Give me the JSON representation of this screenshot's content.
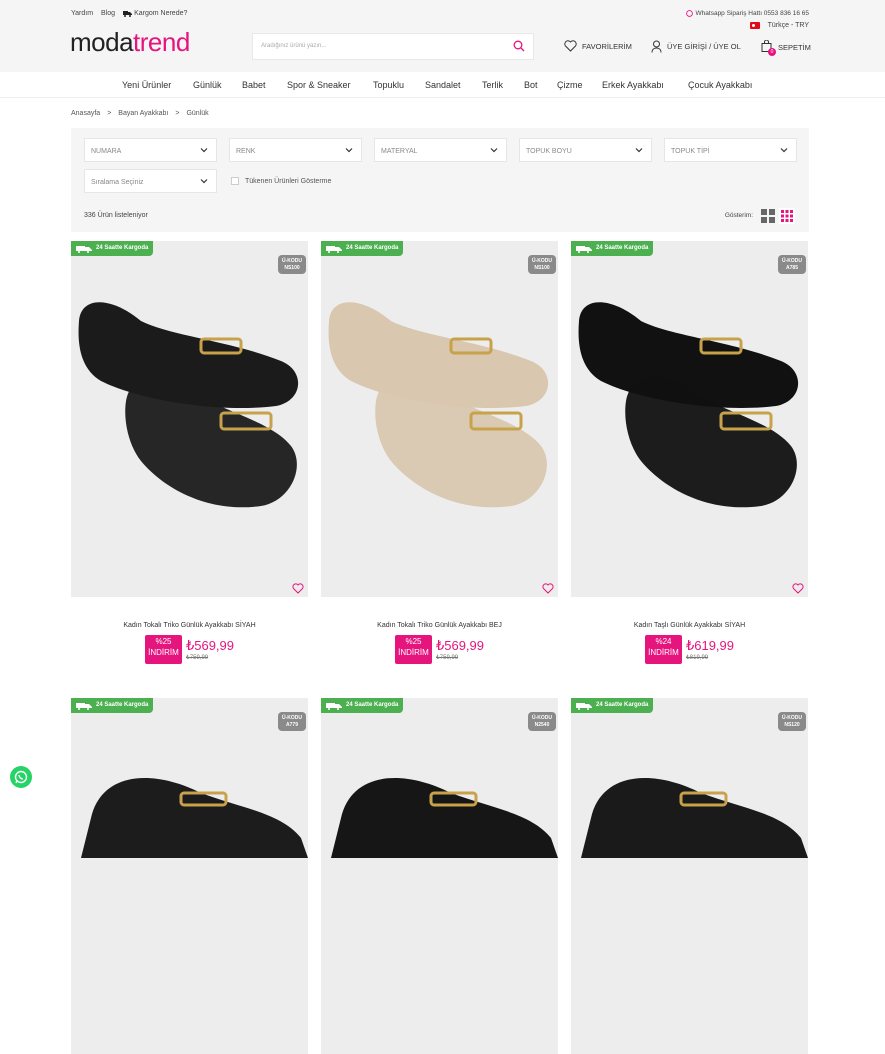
{
  "header": {
    "top_links": [
      "Yardım",
      "Blog",
      "Kargom Nerede?"
    ],
    "logo_dark": "moda",
    "logo_pink": "trend",
    "search_placeholder": "Aradığınız ürünü yazın...",
    "whatsapp": "Whatsapp Sipariş Hattı 0553 836 16 65",
    "language": "Türkçe - TRY",
    "favorites": "FAVORİLERİM",
    "login": "ÜYE GİRİŞİ / ÜYE OL",
    "cart": "SEPETİM",
    "cart_count": "0"
  },
  "nav": [
    "Yeni Ürünler",
    "Günlük",
    "Babet",
    "Spor & Sneaker",
    "Topuklu",
    "Sandalet",
    "Terlik",
    "Bot",
    "Çizme",
    "Erkek Ayakkabı",
    "Çocuk Ayakkabı"
  ],
  "breadcrumb": [
    "Anasayfa",
    ">",
    "Bayan Ayakkabı",
    ">",
    "Günlük"
  ],
  "filters": {
    "selects": [
      "NUMARA",
      "RENK",
      "MATERYAL",
      "TOPUK BOYU",
      "TOPUK TİPİ"
    ],
    "sort": "Sıralama Seçiniz",
    "out_of_stock": "Tükenen Ürünleri Gösterme",
    "count": "336 Ürün listeleniyor",
    "view_label": "Gösterim:"
  },
  "products": [
    {
      "badge": "24 Saatte Kargoda",
      "code_label": "Ü-KODU",
      "code": "NS100",
      "title": "Kadın Tokalı Triko Günlük Ayakkabı SİYAH",
      "discount": "%25",
      "discount_word": "İNDİRİM",
      "price": "₺569,99",
      "old_price": "₺759,99",
      "color": "#1b1b1b"
    },
    {
      "badge": "24 Saatte Kargoda",
      "code_label": "Ü-KODU",
      "code": "NS100",
      "title": "Kadın Tokalı Triko Günlük Ayakkabı BEJ",
      "discount": "%25",
      "discount_word": "İNDİRİM",
      "price": "₺569,99",
      "old_price": "₺759,99",
      "color": "#d9c7b0"
    },
    {
      "badge": "24 Saatte Kargoda",
      "code_label": "Ü-KODU",
      "code": "A785",
      "title": "Kadın Taşlı Günlük Ayakkabı SİYAH",
      "discount": "%24",
      "discount_word": "İNDİRİM",
      "price": "₺619,99",
      "old_price": "₺819,99",
      "color": "#111111"
    },
    {
      "badge": "24 Saatte Kargoda",
      "code_label": "Ü-KODU",
      "code": "A779",
      "color": "#1c1c1c"
    },
    {
      "badge": "24 Saatte Kargoda",
      "code_label": "Ü-KODU",
      "code": "N2540",
      "color": "#161616"
    },
    {
      "badge": "24 Saatte Kargoda",
      "code_label": "Ü-KODU",
      "code": "NS120",
      "color": "#1a1a1a"
    }
  ]
}
